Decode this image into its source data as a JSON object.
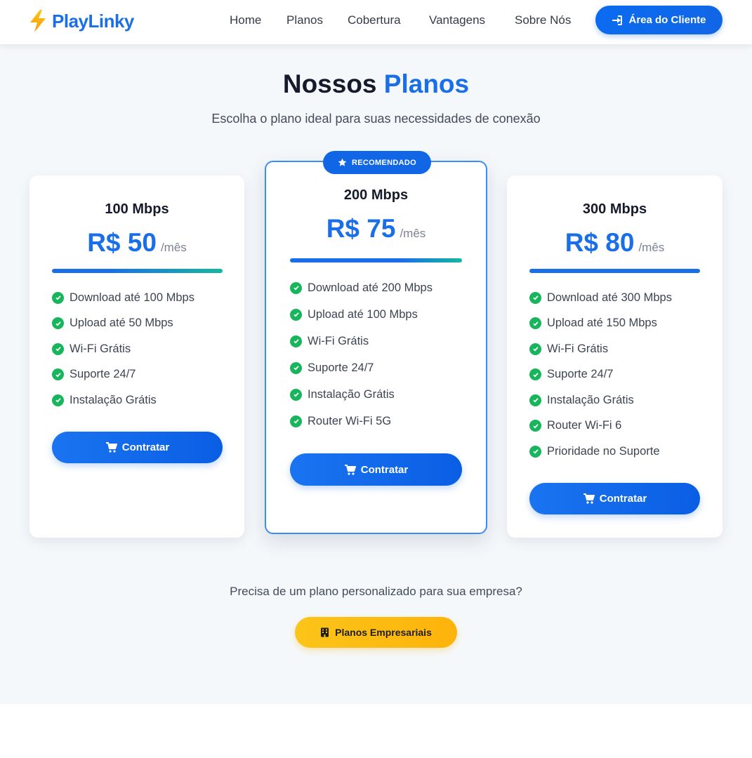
{
  "brand": {
    "name": "PlayLinky",
    "logo_icon": "lightning-icon",
    "primary_color": "#1a6fe8",
    "accent_color": "#fdb30b"
  },
  "nav": {
    "links": [
      "Home",
      "Planos",
      "Cobertura",
      "Vantagens",
      "Sobre Nós"
    ],
    "client_button": "Área do Cliente"
  },
  "section": {
    "title_part1": "Nossos",
    "title_part2": "Planos",
    "subtitle": "Escolha o plano ideal para suas necessidades de conexão"
  },
  "plans": [
    {
      "name": "100 Mbps",
      "price": "R$ 50",
      "period": "/mês",
      "features": [
        "Download até 100 Mbps",
        "Upload até 50 Mbps",
        "Wi-Fi Grátis",
        "Suporte 24/7",
        "Instalação Grátis"
      ],
      "button": "Contratar"
    },
    {
      "name": "200 Mbps",
      "price": "R$ 75",
      "period": "/mês",
      "badge": "RECOMENDADO",
      "features": [
        "Download até 200 Mbps",
        "Upload até 100 Mbps",
        "Wi-Fi Grátis",
        "Suporte 24/7",
        "Instalação Grátis",
        "Router Wi-Fi 5G"
      ],
      "button": "Contratar"
    },
    {
      "name": "300 Mbps",
      "price": "R$ 80",
      "period": "/mês",
      "features": [
        "Download até 300 Mbps",
        "Upload até 150 Mbps",
        "Wi-Fi Grátis",
        "Suporte 24/7",
        "Instalação Grátis",
        "Router Wi-Fi 6",
        "Prioridade no Suporte"
      ],
      "button": "Contratar"
    }
  ],
  "custom": {
    "text": "Precisa de um plano personalizado para sua empresa?",
    "button": "Planos Empresariais"
  }
}
